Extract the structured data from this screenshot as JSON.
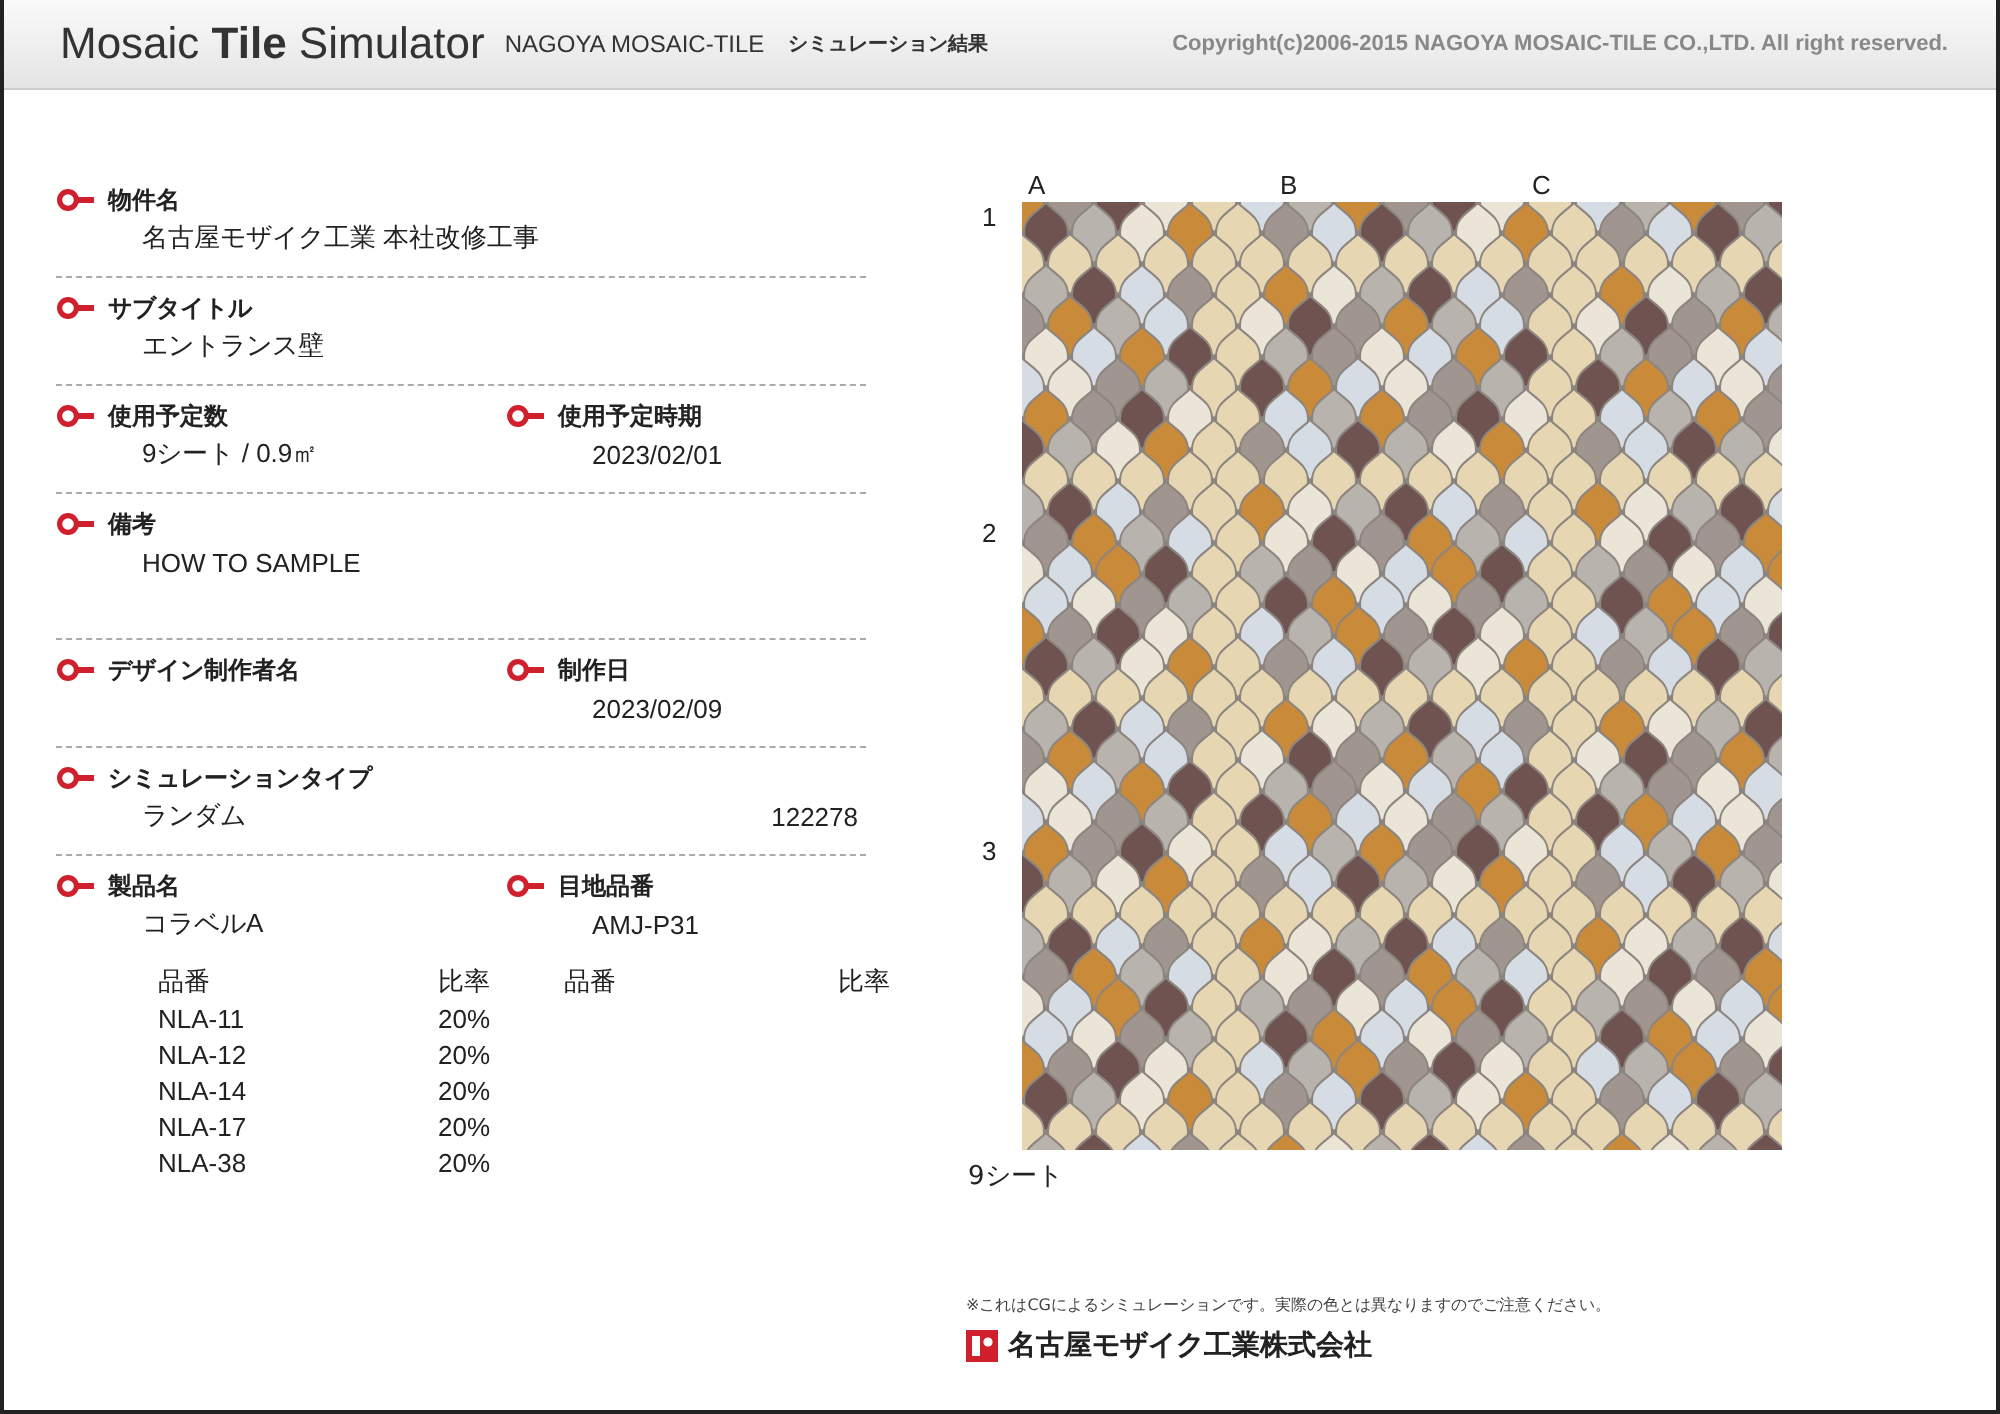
{
  "header": {
    "title": "Mosaic **Tile** Simulator",
    "brand": "NAGOYA MOSAIC-TILE",
    "subtitle": "シミュレーション結果",
    "copyright": "Copyright(c)2006-2015 NAGOYA MOSAIC-TILE CO.,LTD. All right reserved."
  },
  "rows": [
    {
      "fields": [
        {
          "label": "物件名",
          "value": "名古屋モザイク工業 本社改修工事"
        }
      ]
    },
    {
      "fields": [
        {
          "label": "サブタイトル",
          "value": "エントランス壁"
        }
      ]
    },
    {
      "fields": [
        {
          "label": "使用予定数",
          "value": "9シート / 0.9㎡"
        },
        {
          "label": "使用予定時期",
          "value": "2023/02/01"
        }
      ]
    },
    {
      "fields": [
        {
          "label": "備考",
          "value": "HOW TO SAMPLE"
        }
      ]
    },
    {
      "fields": [
        {
          "label": "デザイン制作者名"
        },
        {
          "label": "制作日",
          "value": "2023/02/09"
        }
      ]
    },
    {
      "fields": [
        {
          "label": "シミュレーションタイプ",
          "value": "ランダム",
          "code": "122278"
        }
      ]
    },
    {
      "fields": [
        {
          "label": "製品名",
          "value": "コラベルA",
          "table": {
            "columns": [
              "品番",
              "比率"
            ],
            "rows": [
              [
                "NLA-11",
                "20%"
              ],
              [
                "NLA-12",
                "20%"
              ],
              [
                "NLA-14",
                "20%"
              ],
              [
                "NLA-17",
                "20%"
              ],
              [
                "NLA-38",
                "20%"
              ]
            ]
          }
        },
        {
          "label": "目地品番",
          "value": "AMJ-P31",
          "table": {
            "columns": [
              "品番",
              "比率"
            ]
          }
        }
      ]
    }
  ],
  "mosaic": {
    "column_labels": [
      "A",
      "B",
      "C"
    ],
    "row_labels": [
      "1",
      "2",
      "3"
    ],
    "caption": "9シート"
  },
  "footer": {
    "note": "※これはCGによるシミュレーションです。実際の色とは異なりますのでご注意ください。",
    "company": "名古屋モザイク工業株式会社"
  }
}
